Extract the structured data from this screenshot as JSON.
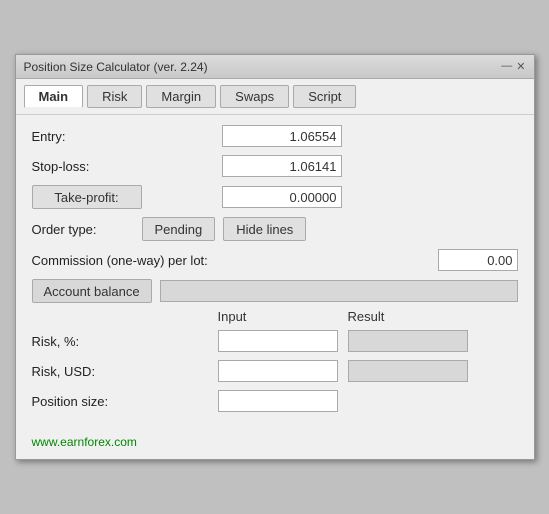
{
  "window": {
    "title": "Position Size Calculator (ver. 2.24)",
    "minimize": "—",
    "close": "✕"
  },
  "tabs": [
    {
      "label": "Main",
      "active": true
    },
    {
      "label": "Risk",
      "active": false
    },
    {
      "label": "Margin",
      "active": false
    },
    {
      "label": "Swaps",
      "active": false
    },
    {
      "label": "Script",
      "active": false
    }
  ],
  "fields": {
    "entry_label": "Entry:",
    "entry_value": "1.06554",
    "stoploss_label": "Stop-loss:",
    "stoploss_value": "1.06141",
    "takeprofit_label": "Take-profit:",
    "takeprofit_value": "0.00000",
    "ordertype_label": "Order type:",
    "ordertype_btn": "Pending",
    "hidelines_btn": "Hide lines",
    "commission_label": "Commission (one-way) per lot:",
    "commission_value": "0.00",
    "account_balance_btn": "Account balance"
  },
  "table": {
    "input_header": "Input",
    "result_header": "Result",
    "rows": [
      {
        "label": "Risk, %:",
        "input": "",
        "result": ""
      },
      {
        "label": "Risk, USD:",
        "input": "",
        "result": ""
      },
      {
        "label": "Position size:",
        "input": "",
        "result": null
      }
    ]
  },
  "footer": {
    "link_text": "www.earnforex.com",
    "link_url": "#"
  }
}
